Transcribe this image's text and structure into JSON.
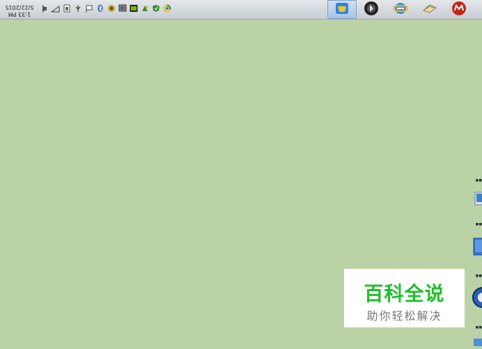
{
  "taskbar": {
    "clock_time": "1:33 PM",
    "clock_date": "5/22/2015",
    "tray_icons": [
      "volume-icon",
      "network-icon",
      "battery-icon",
      "usb-icon",
      "flag-icon",
      "bluetooth-icon",
      "shield-icon",
      "monitor-icon",
      "nvidia-icon",
      "update-icon",
      "security-icon",
      "chrome-icon"
    ],
    "apps": [
      "windows-explorer-icon",
      "media-player-icon",
      "ie-icon",
      "file-manager-icon",
      "office-icon"
    ]
  },
  "watermark": {
    "title": "百科全说",
    "subtitle": "助你轻松解决"
  },
  "colors": {
    "desktop": "#bbd2a6",
    "watermark_green": "#1fbf2a"
  }
}
